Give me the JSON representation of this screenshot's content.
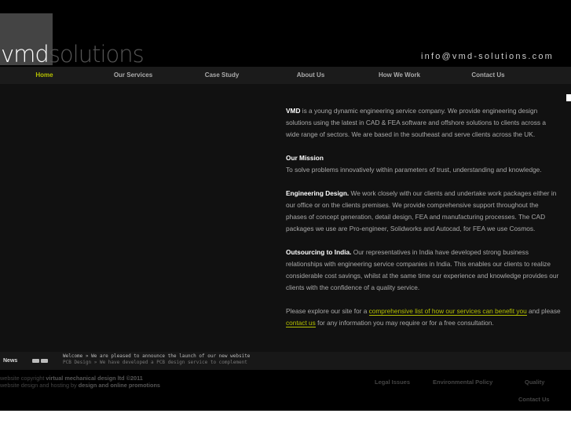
{
  "header": {
    "logo_a": "vmd",
    "logo_b": "solutions",
    "email": "info@vmd-solutions.com"
  },
  "nav": [
    "Home",
    "Our Services",
    "Case Study",
    "About Us",
    "How We Work",
    "Contact Us"
  ],
  "content": {
    "p1_bold": "VMD",
    "p1": " is a young dynamic engineering service company. We provide engineering design solutions using the latest in CAD & FEA software and offshore solutions to clients across a wide range of sectors. We are based in the southeast and serve clients across the UK.",
    "mission_title": "Our Mission",
    "mission": "To solve problems innovatively within parameters of trust, understanding and knowledge.",
    "p3_bold": "Engineering Design.",
    "p3": " We work closely with our clients and undertake work packages either in our office or on the clients premises. We provide comprehensive support throughout the phases of concept generation, detail design, FEA and manufacturing processes. The CAD packages we use are Pro-engineer, Solidworks and Autocad, for FEA we use Cosmos.",
    "p4_bold": "Outsourcing to India.",
    "p4": " Our representatives in India have developed strong business relationships with engineering service companies in India. This enables our clients to realize considerable cost savings, whilst at the same time our experience and knowledge provides our clients with the confidence of a quality service.",
    "p5_a": "Please explore our site for a ",
    "link1": "comprehensive list of how our services can benefit you",
    "p5_b": " and please ",
    "link2": "contact us",
    "p5_c": " for any information you may require or for a free consultation."
  },
  "news": {
    "label": "News",
    "items": [
      "Welcome »  We are pleased to announce the launch of our new website",
      "PCB Design »  We have developed a PCB design service to complement"
    ]
  },
  "footer": {
    "copy_a": "website copyright ",
    "copy_b": "virtual mechanical design ltd ©2011",
    "host_a": "website design and hosting by ",
    "host_b": "design and online promotions",
    "links": [
      "Legal Issues",
      "Environmental Policy",
      "Quality",
      "Contact Us"
    ]
  },
  "colors": {
    "accent": "#b5c000"
  }
}
